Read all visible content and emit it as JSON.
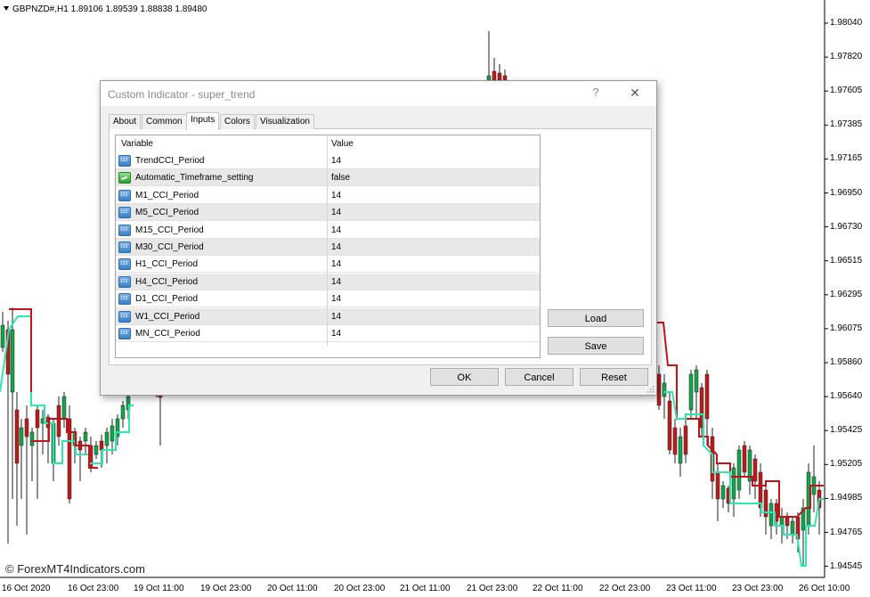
{
  "chart": {
    "symbol_header": "GBPNZD#,H1  1.89106 1.89539 1.88838 1.89480",
    "price_labels": [
      "1.98040",
      "1.97820",
      "1.97605",
      "1.97385",
      "1.97165",
      "1.96950",
      "1.96730",
      "1.96515",
      "1.96295",
      "1.96075",
      "1.95860",
      "1.95640",
      "1.95425",
      "1.95205",
      "1.94985",
      "1.94765",
      "1.94545"
    ],
    "time_labels": [
      "16 Oct 2020",
      "16 Oct 23:00",
      "19 Oct 11:00",
      "19 Oct 23:00",
      "20 Oct 11:00",
      "20 Oct 23:00",
      "21 Oct 11:00",
      "21 Oct 23:00",
      "22 Oct 11:00",
      "22 Oct 23:00",
      "23 Oct 11:00",
      "23 Oct 23:00",
      "26 Oct 10:00"
    ],
    "watermark": "© ForexMT4Indicators.com",
    "colors": {
      "bull": "#16a34a",
      "bear": "#b91c1c",
      "trend_up": "#2ee6b0",
      "trend_down": "#c0141c"
    }
  },
  "dialog": {
    "title": "Custom Indicator - super_trend",
    "help_glyph": "?",
    "close_glyph": "✕",
    "tabs": [
      "About",
      "Common",
      "Inputs",
      "Colors",
      "Visualization"
    ],
    "active_tab": "Inputs",
    "columns": {
      "variable": "Variable",
      "value": "Value"
    },
    "rows": [
      {
        "icon": "int-icon",
        "variable": "TrendCCI_Period",
        "value": "14"
      },
      {
        "icon": "bool-icon",
        "variable": "Automatic_Timeframe_setting",
        "value": "false"
      },
      {
        "icon": "int-icon",
        "variable": "M1_CCI_Period",
        "value": "14"
      },
      {
        "icon": "int-icon",
        "variable": "M5_CCI_Period",
        "value": "14"
      },
      {
        "icon": "int-icon",
        "variable": "M15_CCI_Period",
        "value": "14"
      },
      {
        "icon": "int-icon",
        "variable": "M30_CCI_Period",
        "value": "14"
      },
      {
        "icon": "int-icon",
        "variable": "H1_CCI_Period",
        "value": "14"
      },
      {
        "icon": "int-icon",
        "variable": "H4_CCI_Period",
        "value": "14"
      },
      {
        "icon": "int-icon",
        "variable": "D1_CCI_Period",
        "value": "14"
      },
      {
        "icon": "int-icon",
        "variable": "W1_CCI_Period",
        "value": "14"
      },
      {
        "icon": "int-icon",
        "variable": "MN_CCI_Period",
        "value": "14"
      }
    ],
    "buttons": {
      "load": "Load",
      "save": "Save",
      "ok": "OK",
      "cancel": "Cancel",
      "reset": "Reset"
    }
  }
}
